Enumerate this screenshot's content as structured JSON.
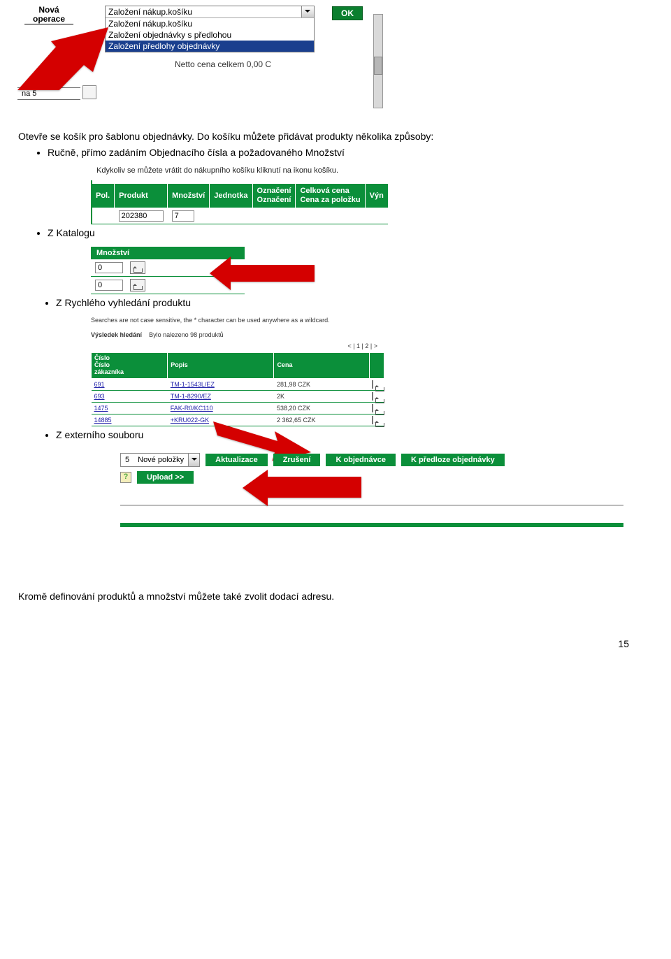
{
  "shot1": {
    "newOperationLabel": "Nová\noperace",
    "dropdownSelected": "Založení nákup.košíku",
    "dropdownItems": [
      "Založení nákup.košíku",
      "Založení objednávky s předlohou",
      "Založení předlohy objednávky"
    ],
    "okLabel": "OK",
    "nettoLine": "Netto cena celkem  0,00 C",
    "bottomText": "na 5"
  },
  "paragraph1a": "Otevře se košík pro šablonu objednávky. Do košíku můžete přidávat produkty několika způsoby:",
  "bullet1": "Ručně, přímo zadáním Objednacího čísla a požadovaného Množství",
  "shot2": {
    "hint": "Kdykoliv se můžete vrátit do nákupního košíku kliknutí na ikonu košíku.",
    "headers": {
      "pol": "Pol.",
      "produkt": "Produkt",
      "mnozstvi": "Množství",
      "jednotka": "Jednotka",
      "oznaceni": "Označení\nOznačení",
      "cena": "Celková cena\nCena za položku",
      "vyn": "Výn"
    },
    "row": {
      "produkt": "202380",
      "mnozstvi": "7"
    }
  },
  "bullet2": "Z Katalogu",
  "shot3": {
    "header": "Množství",
    "rows": [
      "0",
      "0"
    ]
  },
  "bullet3": "Z Rychlého vyhledání produktu",
  "shot4": {
    "note": "Searches are not case sensitive, the * character can be used anywhere as a wildcard.",
    "resultLabel": "Výsledek hledání",
    "resultCount": "Bylo nalezeno 98 produktů",
    "pager": "< | 1 | 2 | >",
    "headers": {
      "cislo": "Číslo\nČíslo\nzákazníka",
      "popis": "Popis",
      "cena": "Cena",
      "blank": ""
    },
    "rows": [
      {
        "cislo": "691",
        "popis": "TM-1-1543L/EZ",
        "cena": "281,98 CZK"
      },
      {
        "cislo": "693",
        "popis": "TM-1-8290/EZ",
        "cena": "2K"
      },
      {
        "cislo": "1475",
        "popis": "FAK-R0/KC110",
        "cena": "538,20 CZK"
      },
      {
        "cislo": "14885",
        "popis": "+KRU022-GK",
        "cena": "2 362,65 CZK"
      }
    ]
  },
  "bullet4": "Z externího souboru",
  "shot5": {
    "comboValue": "5",
    "comboLabel": "Nové položky",
    "btnAktualizace": "Aktualizace",
    "btnZruseni": "Zrušení",
    "btnKObjednavce": "K objednávce",
    "btnKPredloze": "K předloze objednávky",
    "btnUpload": "Upload >>",
    "helpGlyph": "?"
  },
  "footer": "Kromě definování produktů a množství můžete také zvolit dodací adresu.",
  "pageNumber": "15"
}
